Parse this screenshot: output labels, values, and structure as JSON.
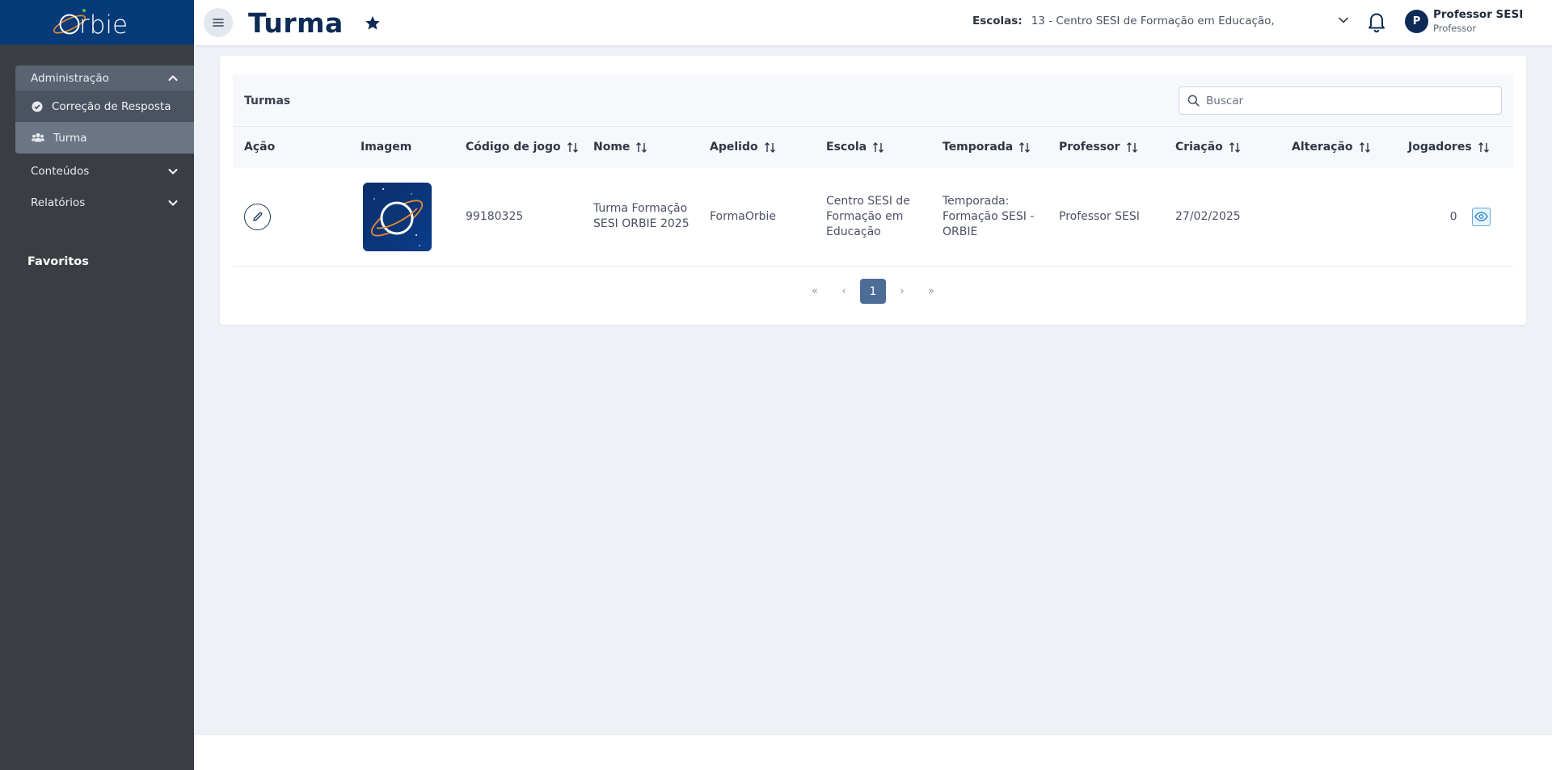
{
  "brand": {
    "name": "Orbie"
  },
  "sidebar": {
    "groups": [
      {
        "label": "Administração",
        "expanded": true,
        "items": [
          {
            "label": "Correção de Resposta",
            "icon": "check-circle-icon"
          },
          {
            "label": "Turma",
            "icon": "users-icon",
            "active": true
          }
        ]
      },
      {
        "label": "Conteúdos",
        "expanded": false
      },
      {
        "label": "Relatórios",
        "expanded": false
      }
    ],
    "favorites_label": "Favoritos"
  },
  "header": {
    "title": "Turma",
    "escolas_label": "Escolas:",
    "escolas_value": "13 - Centro SESI de Formação em Educação,",
    "user": {
      "initial": "P",
      "name": "Professor SESI",
      "role": "Professor"
    }
  },
  "panel": {
    "title": "Turmas",
    "search_placeholder": "Buscar",
    "columns": [
      "Ação",
      "Imagem",
      "Código de jogo",
      "Nome",
      "Apelido",
      "Escola",
      "Temporada",
      "Professor",
      "Criação",
      "Alteração",
      "Jogadores"
    ],
    "rows": [
      {
        "codigo": "99180325",
        "nome": "Turma Formação SESI ORBIE 2025",
        "apelido": "FormaOrbie",
        "escola": "Centro SESI de Formação em Educação",
        "temporada": "Temporada: Formação SESI - ORBIE",
        "professor": "Professor SESI",
        "criacao": "27/02/2025",
        "alteracao": "",
        "jogadores": "0"
      }
    ],
    "pagination": {
      "first": "«",
      "prev": "‹",
      "current": "1",
      "next": "›",
      "last": "»"
    }
  },
  "colors": {
    "brand_navy": "#073a78",
    "sidebar_bg": "#3a3d43",
    "title_navy": "#0d2b55",
    "page_active": "#4d6c96"
  }
}
